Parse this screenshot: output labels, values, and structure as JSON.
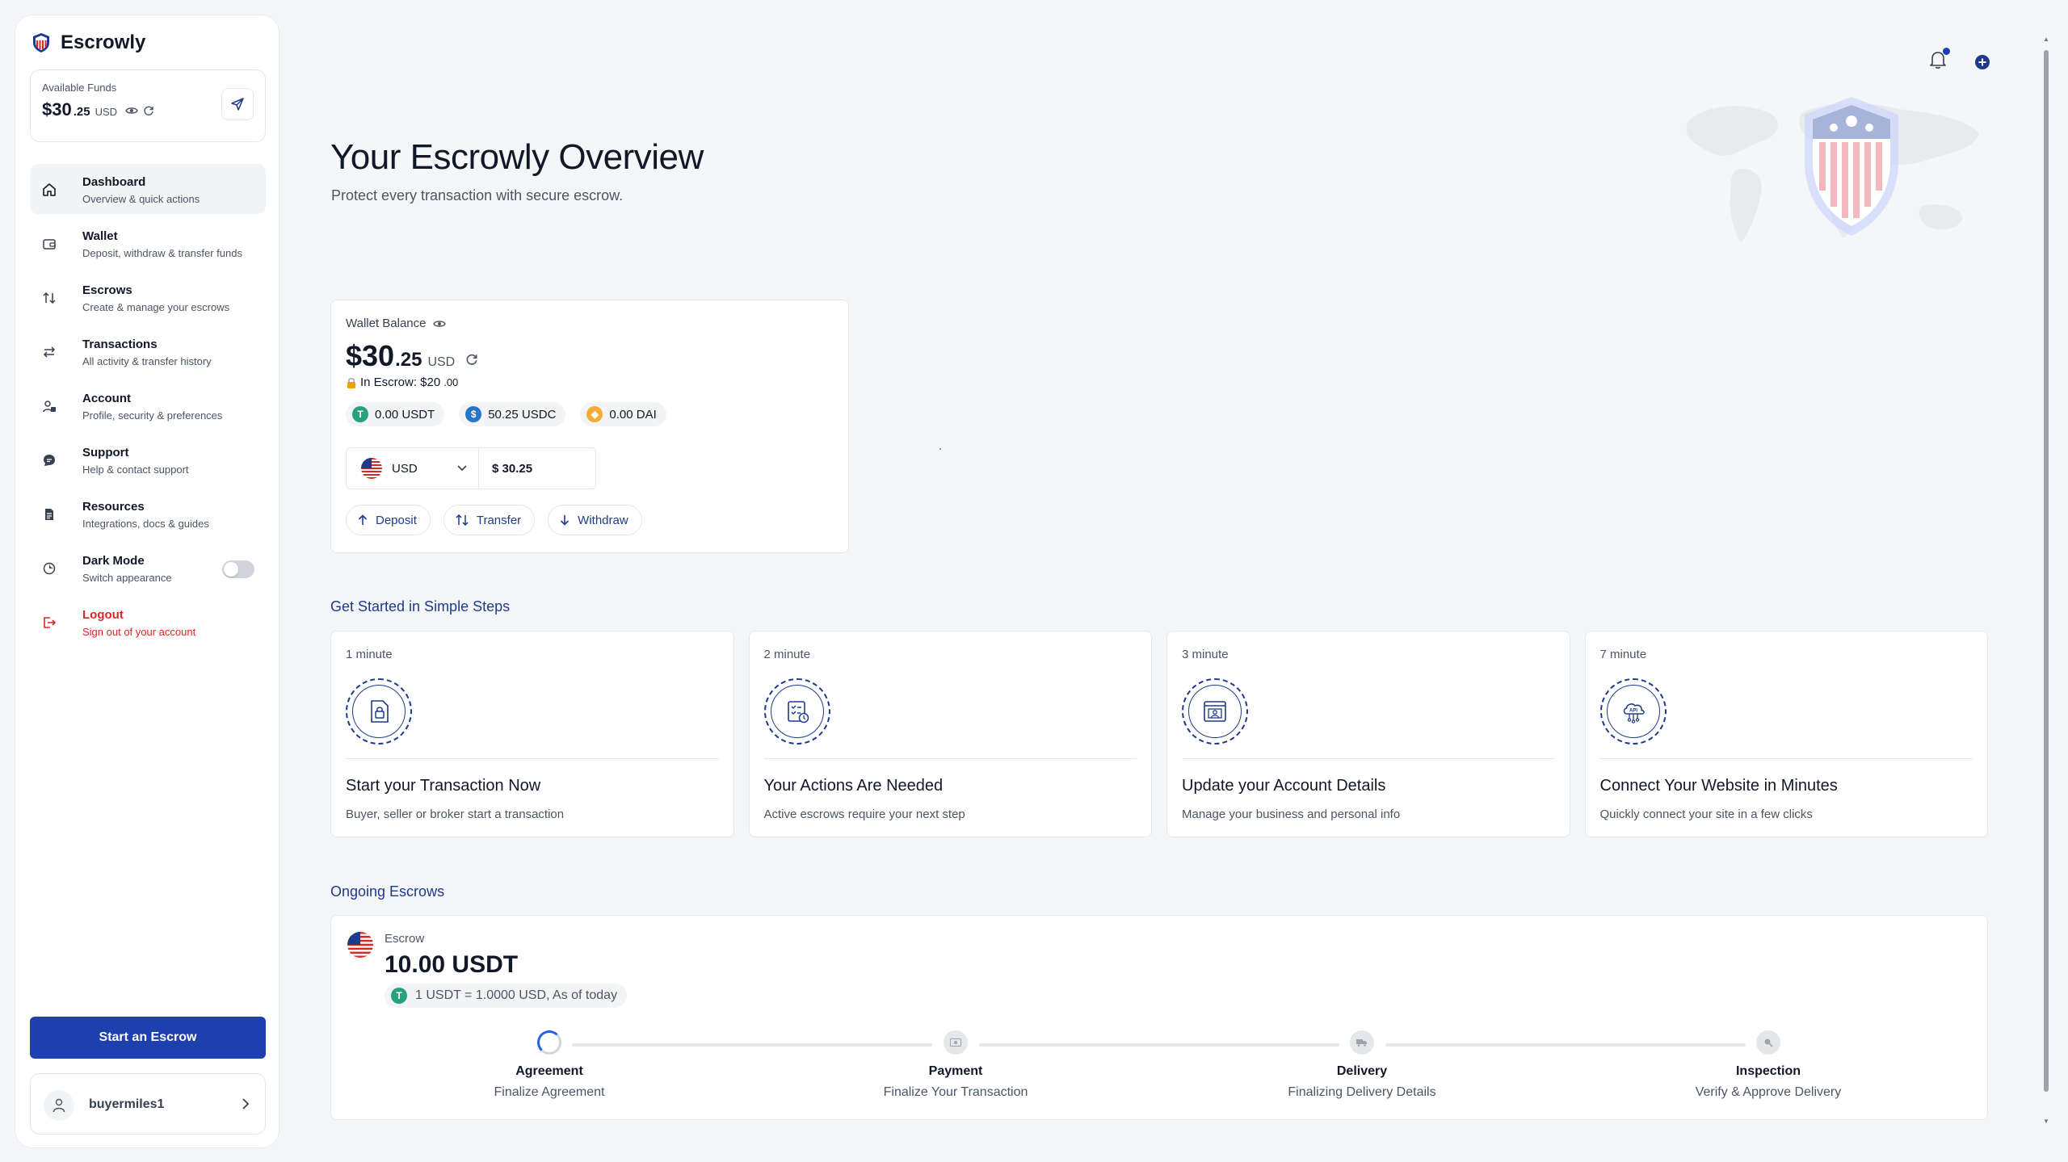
{
  "sidebar": {
    "brand": "Escrowly",
    "funds": {
      "label": "Available Funds",
      "main": "$30",
      "cents": ".25",
      "currency": "USD"
    },
    "nav": [
      {
        "title": "Dashboard",
        "sub": "Overview & quick actions",
        "icon": "home-icon"
      },
      {
        "title": "Wallet",
        "sub": "Deposit, withdraw & transfer funds",
        "icon": "wallet-icon"
      },
      {
        "title": "Escrows",
        "sub": "Create & manage your escrows",
        "icon": "swap-vertical-icon"
      },
      {
        "title": "Transactions",
        "sub": "All activity & transfer history",
        "icon": "swap-horizontal-icon"
      },
      {
        "title": "Account",
        "sub": "Profile, security & preferences",
        "icon": "account-icon"
      },
      {
        "title": "Support",
        "sub": "Help & contact support",
        "icon": "support-icon"
      },
      {
        "title": "Resources",
        "sub": "Integrations, docs & guides",
        "icon": "document-icon"
      },
      {
        "title": "Dark Mode",
        "sub": "Switch appearance",
        "icon": "moon-icon"
      },
      {
        "title": "Logout",
        "sub": "Sign out of your account",
        "icon": "logout-icon"
      }
    ],
    "start_button": "Start an Escrow",
    "username": "buyermiles1"
  },
  "header": {
    "title": "Your Escrowly Overview",
    "subtitle": "Protect every transaction with secure escrow."
  },
  "wallet": {
    "label": "Wallet Balance",
    "main": "$30",
    "cents": ".25",
    "currency": "USD",
    "in_escrow_label": "In Escrow: $20",
    "in_escrow_cents": ".00",
    "chips": [
      {
        "text": "0.00 USDT",
        "symbol": "T",
        "color": "#26a17b"
      },
      {
        "text": "50.25 USDC",
        "symbol": "$",
        "color": "#2775ca"
      },
      {
        "text": "0.00 DAI",
        "symbol": "◈",
        "color": "#f5ac37"
      }
    ],
    "converter": {
      "currency": "USD",
      "amount": "$ 30.25"
    },
    "actions": {
      "deposit": "Deposit",
      "transfer": "Transfer",
      "withdraw": "Withdraw"
    }
  },
  "steps_section": {
    "title": "Get Started in Simple Steps",
    "steps": [
      {
        "time": "1 minute",
        "title": "Start your Transaction Now",
        "sub": "Buyer, seller or broker start a transaction"
      },
      {
        "time": "2 minute",
        "title": "Your Actions Are Needed",
        "sub": "Active escrows require your next step"
      },
      {
        "time": "3 minute",
        "title": "Update your Account Details",
        "sub": "Manage your business and personal info"
      },
      {
        "time": "7 minute",
        "title": "Connect Your Website in Minutes",
        "sub": "Quickly connect your site in a few clicks"
      }
    ]
  },
  "ongoing": {
    "title": "Ongoing Escrows",
    "label": "Escrow",
    "amount": "10.00 USDT",
    "rate": "1 USDT = 1.0000 USD, As of today",
    "stages": [
      {
        "title": "Agreement",
        "sub": "Finalize Agreement"
      },
      {
        "title": "Payment",
        "sub": "Finalize Your Transaction"
      },
      {
        "title": "Delivery",
        "sub": "Finalizing Delivery Details"
      },
      {
        "title": "Inspection",
        "sub": "Verify & Approve Delivery"
      }
    ]
  },
  "colors": {
    "primary": "#1e40af",
    "danger": "#dc2626",
    "accent_text": "#1e3a8a"
  }
}
